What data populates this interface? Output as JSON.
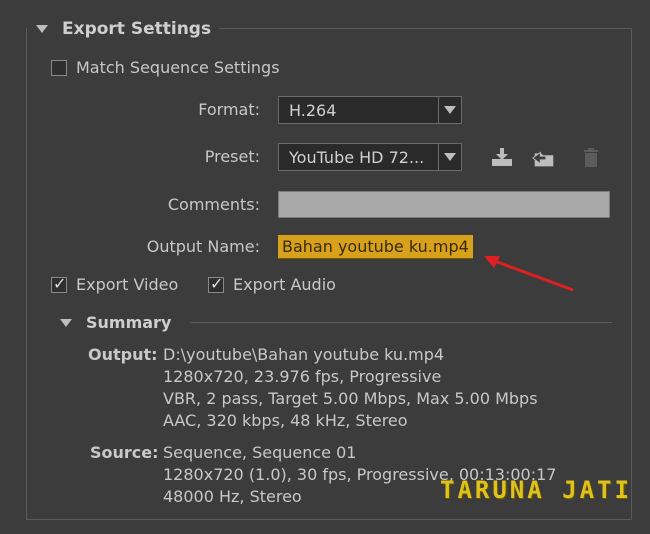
{
  "section": {
    "title": "Export Settings"
  },
  "match_sequence": {
    "label": "Match Sequence Settings",
    "checked": false
  },
  "format": {
    "label": "Format:",
    "value": "H.264"
  },
  "preset": {
    "label": "Preset:",
    "value": "YouTube HD 72...",
    "icons": [
      "save-preset-icon",
      "import-preset-icon",
      "delete-preset-icon"
    ]
  },
  "comments": {
    "label": "Comments:",
    "value": ""
  },
  "output_name": {
    "label": "Output Name:",
    "value": "Bahan youtube ku.mp4"
  },
  "export_video": {
    "label": "Export Video",
    "checked": true
  },
  "export_audio": {
    "label": "Export Audio",
    "checked": true
  },
  "summary": {
    "title": "Summary",
    "output_label": "Output:",
    "output_lines": [
      "D:\\youtube\\Bahan youtube ku.mp4",
      "1280x720, 23.976 fps, Progressive",
      "VBR, 2 pass, Target 5.00 Mbps, Max 5.00 Mbps",
      "AAC, 320 kbps, 48 kHz, Stereo"
    ],
    "source_label": "Source:",
    "source_lines": [
      "Sequence, Sequence 01",
      "1280x720 (1.0), 30 fps, Progressive, 00:13:00:17",
      "48000 Hz, Stereo"
    ]
  },
  "watermark": "TARUNA JATI",
  "colors": {
    "highlight": "#d7a11c",
    "arrow": "#e02020"
  }
}
